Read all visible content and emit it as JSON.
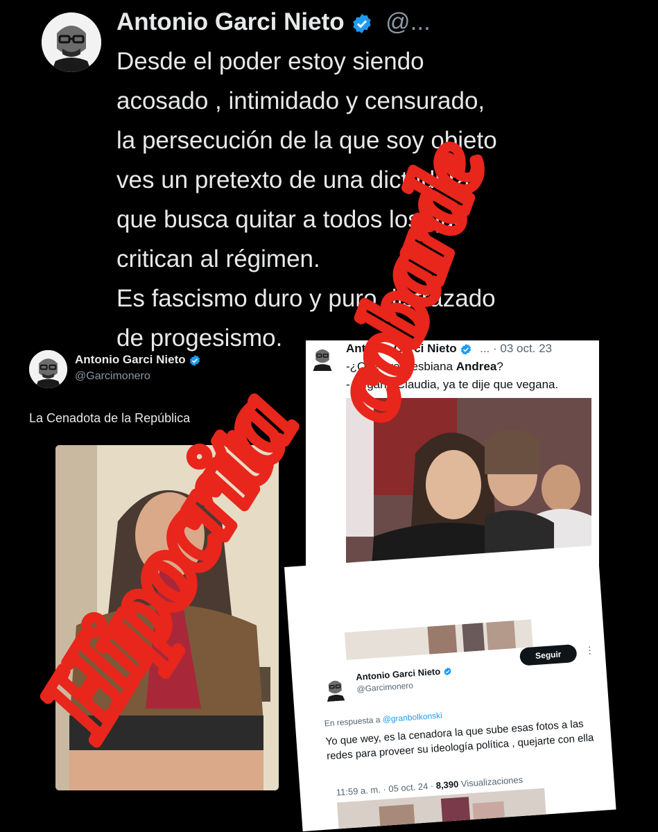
{
  "main_tweet": {
    "name": "Antonio Garci Nieto",
    "handle": "@...",
    "lines": [
      "Desde el poder estoy siendo",
      "acosado , intimidado y censurado,",
      "la persecución de la que soy objeto",
      "ves un pretexto de una dictadura",
      "que busca quitar a todos los que",
      "critican al régimen.",
      "Es fascismo duro y puro disfrazado",
      "de progesismo."
    ]
  },
  "left_tweet": {
    "name": "Antonio Garci Nieto",
    "handle": "@Garcimonero",
    "text": "La Cenadota de la República"
  },
  "top_right_tweet": {
    "name": "Antonio Garci Nieto",
    "meta": "... · 03 oct. 23",
    "line1_prefix": "-¿Que eres lesbiana ",
    "line1_bold": "Andrea",
    "line1_suffix": "?",
    "line2": "- Vegana Claudia, ya te dije que vegana."
  },
  "bottom_right_tweet": {
    "name": "Antonio Garci Nieto",
    "handle": "@Garcimonero",
    "follow_label": "Seguir",
    "reply_prefix": "En respuesta a ",
    "reply_handle": "@granbolkonski",
    "text": "Yo que wey, es la cenadora la que sube esas fotos a las redes para proveer su ideología política , quejarte con ella",
    "time": "11:59 a. m. · 05 oct. 24 · ",
    "views_count": "8,390",
    "views_label": " Visualizaciones"
  },
  "overlay_words": [
    "cobarde",
    "Hipocrita"
  ],
  "colors": {
    "verified": "#1d9bf0",
    "overlay": "#e8261b",
    "background": "#000000"
  }
}
